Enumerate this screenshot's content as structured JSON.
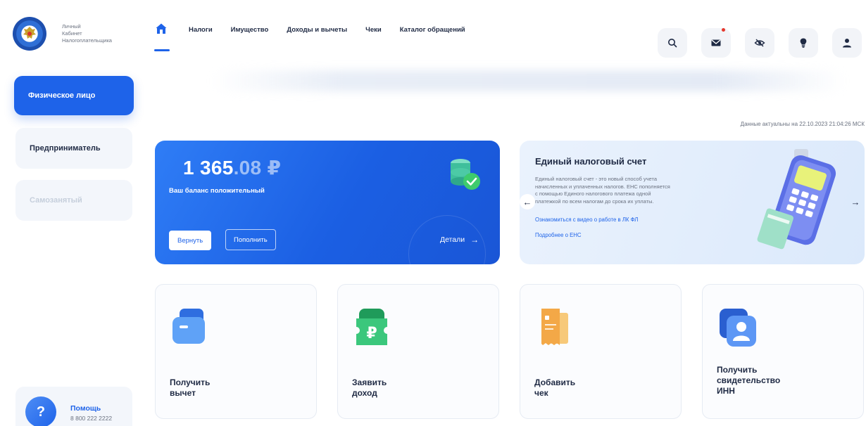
{
  "logo": {
    "line1": "Личный",
    "line2": "Кабинет",
    "line3": "Налогоплательщика"
  },
  "nav": {
    "items": [
      "Налоги",
      "Имущество",
      "Доходы и вычеты",
      "Чеки",
      "Каталог обращений"
    ]
  },
  "top_icons": [
    "search-icon",
    "mail-icon",
    "eye-off-icon",
    "bulb-icon",
    "user-icon"
  ],
  "sidebar": {
    "tabs": [
      {
        "label": "Физическое лицо",
        "active": true
      },
      {
        "label": "Предприниматель",
        "active": false
      },
      {
        "label": "Самозанятый",
        "active": false
      }
    ],
    "help": {
      "title": "Помощь",
      "phone": "8 800 222 2222"
    }
  },
  "data_updated": "Данные актуальны на 22.10.2023 21:04:26 МСК",
  "balance": {
    "amount_int": "1 365",
    "amount_dec": ".08 ₽",
    "status": "Ваш баланс положительный",
    "return_label": "Вернуть",
    "topup_label": "Пополнить",
    "details_label": "Детали"
  },
  "ens": {
    "title": "Единый налоговый счет",
    "desc_l1": "Единый налоговый счет - это новый способ учета",
    "desc_l2": "начисленных и уплаченных налогов. ЕНС пополняется",
    "desc_l3": "с помощью Единого налогового платежа одной",
    "desc_l4": "платежкой по всем налогам до срока их уплаты.",
    "link_prefix": "Ознакомиться с",
    "link_video": "видео о работе в ЛК ФЛ",
    "link_more": "Подробнее о ЕНС"
  },
  "tiles": [
    {
      "line1": "Получить",
      "line2": "вычет",
      "line3": ""
    },
    {
      "line1": "Заявить",
      "line2": "доход",
      "line3": ""
    },
    {
      "line1": "Добавить",
      "line2": "чек",
      "line3": ""
    },
    {
      "line1": "Получить",
      "line2": "свидетельство",
      "line3": "ИНН"
    }
  ],
  "colors": {
    "accent": "#1e63e9",
    "notification": "#e5372c",
    "check_green": "#3ecb6d",
    "tile_green": "#34b36a",
    "tile_orange": "#f3a847"
  }
}
